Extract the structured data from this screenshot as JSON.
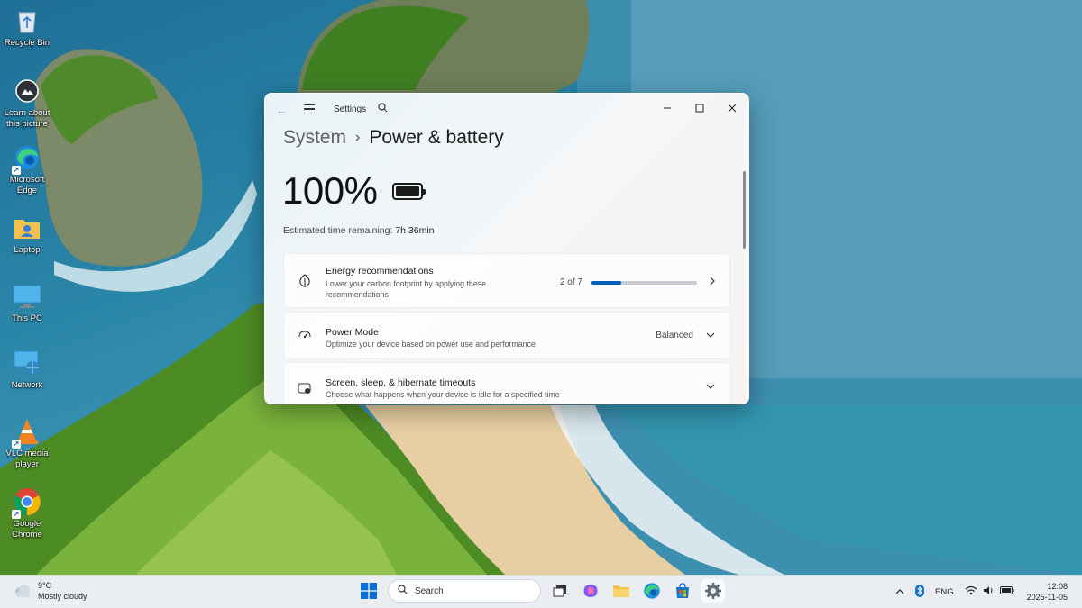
{
  "desktop": {
    "icons": [
      {
        "label": "Recycle Bin"
      },
      {
        "label": "Learn about this picture"
      },
      {
        "label": "Microsoft Edge"
      },
      {
        "label": "Laptop"
      },
      {
        "label": "This PC"
      },
      {
        "label": "Network"
      },
      {
        "label": "VLC media player"
      },
      {
        "label": "Google Chrome"
      }
    ]
  },
  "window": {
    "app_title": "Settings",
    "breadcrumb": {
      "parent": "System",
      "current": "Power & battery"
    },
    "battery_percent": "100%",
    "battery_level": 1.0,
    "estimated_label": "Estimated time remaining:",
    "estimated_value": "7h 36min",
    "cards": [
      {
        "title": "Energy recommendations",
        "subtitle": "Lower your carbon footprint by applying these recommendations",
        "status": "2 of 7",
        "progress": 0.2857,
        "icon": "leaf-icon"
      },
      {
        "title": "Power Mode",
        "subtitle": "Optimize your device based on power use and performance",
        "status": "Balanced",
        "icon": "power-mode-icon"
      },
      {
        "title": "Screen, sleep, & hibernate timeouts",
        "subtitle": "Choose what happens when your device is idle for a specified time",
        "icon": "sleep-screen-icon"
      }
    ],
    "accent": "#005fb8"
  },
  "taskbar": {
    "weather": {
      "temp": "9°C",
      "condition": "Mostly cloudy"
    },
    "search_placeholder": "Search",
    "tray": {
      "language": "ENG",
      "time": "12:08",
      "date": "2025-11-05"
    }
  }
}
